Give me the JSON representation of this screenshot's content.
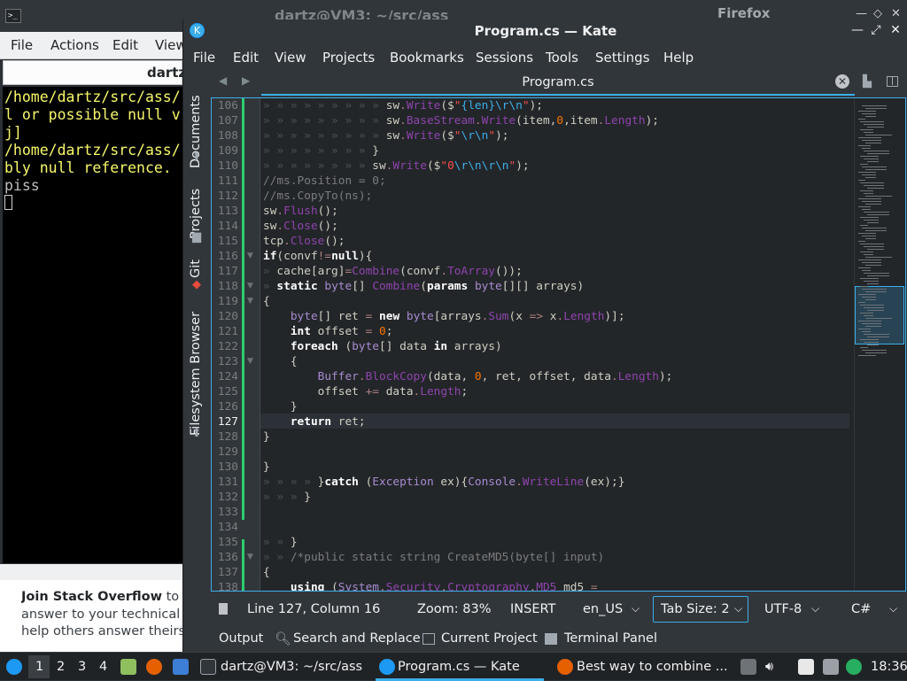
{
  "background": {
    "terminal_title": "dartz@VM3: ~/src/ass",
    "firefox_title": "Firefox",
    "terminal_menu": [
      "File",
      "Actions",
      "Edit",
      "View"
    ],
    "terminal_tab": "dartz",
    "terminal_lines": [
      "/home/dartz/src/ass/",
      "l or possible null v",
      "j]",
      "/home/dartz/src/ass/",
      "bly null reference.",
      "piss"
    ],
    "so_bold": "Join Stack Overflow",
    "so_line1": "to fin",
    "so_line2": "answer to your technical qu",
    "so_line3": "help others answer theirs."
  },
  "kate": {
    "title": "Program.cs  — Kate",
    "menu": [
      "File",
      "Edit",
      "View",
      "Projects",
      "Bookmarks",
      "Sessions",
      "Tools",
      "Settings",
      "Help"
    ],
    "side_tabs": [
      "Documents",
      "Projects",
      "Git",
      "Filesystem Browser"
    ],
    "tab_label": "Program.cs",
    "current_line": 127,
    "code_lines": [
      {
        "n": 106,
        "indent": 9,
        "code": "sw.Write($\"{len}\\r\\n\");"
      },
      {
        "n": 107,
        "indent": 9,
        "code": "sw.BaseStream.Write(item,0,item.Length);"
      },
      {
        "n": 108,
        "indent": 9,
        "code": "sw.Write($\"\\r\\n\");"
      },
      {
        "n": 109,
        "indent": 8,
        "code": "}"
      },
      {
        "n": 110,
        "indent": 8,
        "code": "sw.Write($\"0\\r\\n\\r\\n\");"
      },
      {
        "n": 111,
        "indent": 0,
        "code": "//ms.Position = 0;"
      },
      {
        "n": 112,
        "indent": 0,
        "code": "//ms.CopyTo(ns);"
      },
      {
        "n": 113,
        "indent": 0,
        "code": "sw.Flush();"
      },
      {
        "n": 114,
        "indent": 0,
        "code": "sw.Close();"
      },
      {
        "n": 115,
        "indent": 0,
        "code": "tcp.Close();"
      },
      {
        "n": 116,
        "indent": 0,
        "code": "if(convf!=null){"
      },
      {
        "n": 117,
        "indent": 1,
        "code": "cache[arg]=Combine(convf.ToArray());"
      },
      {
        "n": 118,
        "indent": 1,
        "code": "static byte[] Combine(params byte[][] arrays)"
      },
      {
        "n": 119,
        "indent": 0,
        "code": "{"
      },
      {
        "n": 120,
        "indent": 0,
        "code": "    byte[] ret = new byte[arrays.Sum(x => x.Length)];"
      },
      {
        "n": 121,
        "indent": 0,
        "code": "    int offset = 0;"
      },
      {
        "n": 122,
        "indent": 0,
        "code": "    foreach (byte[] data in arrays)"
      },
      {
        "n": 123,
        "indent": 0,
        "code": "    {"
      },
      {
        "n": 124,
        "indent": 0,
        "code": "        Buffer.BlockCopy(data, 0, ret, offset, data.Length);"
      },
      {
        "n": 125,
        "indent": 0,
        "code": "        offset += data.Length;"
      },
      {
        "n": 126,
        "indent": 0,
        "code": "    }"
      },
      {
        "n": 127,
        "indent": 0,
        "code": "    return ret;"
      },
      {
        "n": 128,
        "indent": 0,
        "code": "}"
      },
      {
        "n": 129,
        "indent": 0,
        "code": ""
      },
      {
        "n": 130,
        "indent": 0,
        "code": "}"
      },
      {
        "n": 131,
        "indent": 4,
        "code": "}catch (Exception ex){Console.WriteLine(ex);}"
      },
      {
        "n": 132,
        "indent": 3,
        "code": "}"
      },
      {
        "n": 133,
        "indent": 0,
        "code": ""
      },
      {
        "n": 134,
        "indent": 0,
        "code": ""
      },
      {
        "n": 135,
        "indent": 2,
        "code": "}"
      },
      {
        "n": 136,
        "indent": 2,
        "code": "/*public static string CreateMD5(byte[] input)"
      },
      {
        "n": 137,
        "indent": 0,
        "code": "{"
      },
      {
        "n": 138,
        "indent": 0,
        "code": "    using (System.Security.Cryptography.MD5 md5 ="
      }
    ],
    "status": {
      "position": "Line 127, Column 16",
      "zoom": "Zoom: 83%",
      "mode": "INSERT",
      "locale": "en_US",
      "tab_size": "Tab Size: 2",
      "encoding": "UTF-8",
      "language": "C#"
    },
    "toolviews": [
      "Output",
      "Search and Replace",
      "Current Project",
      "Terminal Panel"
    ]
  },
  "taskbar": {
    "workspaces": [
      "1",
      "2",
      "3",
      "4"
    ],
    "tasks": [
      "dartz@VM3: ~/src/ass",
      "Program.cs — Kate",
      "Best way to combine ..."
    ],
    "clock": "18:36"
  }
}
